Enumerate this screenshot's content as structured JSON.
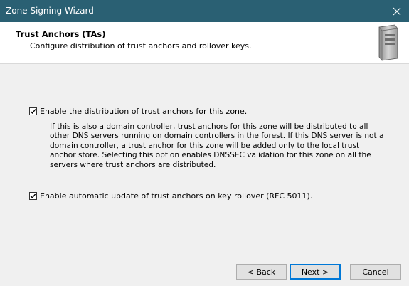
{
  "window": {
    "title": "Zone Signing Wizard"
  },
  "header": {
    "title": "Trust Anchors (TAs)",
    "subtitle": "Configure distribution of trust anchors and rollover keys.",
    "icon": "server-icon"
  },
  "options": {
    "distribute": {
      "label": "Enable the distribution of trust anchors for this zone.",
      "checked": true,
      "description": "If this is also a domain controller, trust anchors for this zone will be distributed to all other DNS servers running on domain controllers in the forest. If this DNS server is not a domain controller, a trust anchor for this zone will be added only to the local trust anchor store. Selecting this option enables DNSSEC validation for this zone on all the servers where trust anchors are distributed."
    },
    "auto_update": {
      "label": "Enable automatic update of trust anchors on key rollover (RFC 5011).",
      "checked": true
    }
  },
  "buttons": {
    "back": "< Back",
    "next": "Next >",
    "cancel": "Cancel"
  },
  "colors": {
    "titlebar": "#2a6073",
    "accent": "#0078d7",
    "background": "#f0f0f0"
  }
}
